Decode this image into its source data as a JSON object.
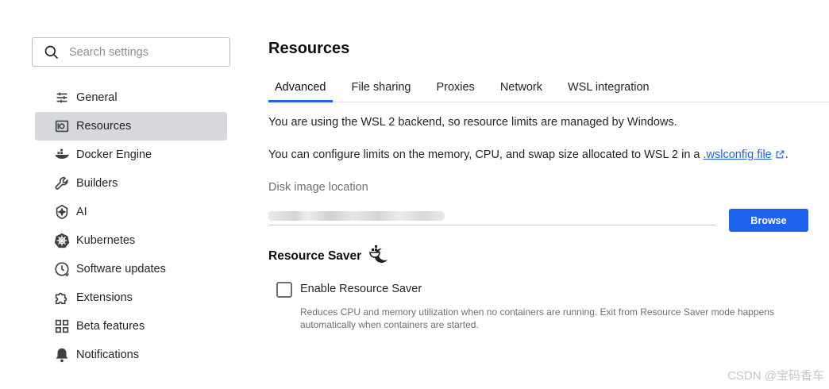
{
  "search": {
    "placeholder": "Search settings"
  },
  "sidebar": {
    "items": [
      {
        "label": "General",
        "icon": "sliders-icon"
      },
      {
        "label": "Resources",
        "icon": "resources-icon",
        "active": true
      },
      {
        "label": "Docker Engine",
        "icon": "docker-whale-icon"
      },
      {
        "label": "Builders",
        "icon": "wrench-icon"
      },
      {
        "label": "AI",
        "icon": "ai-sparkle-icon"
      },
      {
        "label": "Kubernetes",
        "icon": "kubernetes-helm-icon"
      },
      {
        "label": "Software updates",
        "icon": "clock-update-icon"
      },
      {
        "label": "Extensions",
        "icon": "puzzle-icon"
      },
      {
        "label": "Beta features",
        "icon": "grid-icon"
      },
      {
        "label": "Notifications",
        "icon": "bell-icon"
      }
    ]
  },
  "main": {
    "title": "Resources",
    "tabs": [
      {
        "label": "Advanced",
        "active": true
      },
      {
        "label": "File sharing"
      },
      {
        "label": "Proxies"
      },
      {
        "label": "Network"
      },
      {
        "label": "WSL integration"
      }
    ],
    "wsl_notice": "You are using the WSL 2 backend, so resource limits are managed by Windows.",
    "limits_text": "You can configure limits on the memory, CPU, and swap size allocated to WSL 2 in a ",
    "limits_link": ".wslconfig file",
    "limits_end": ".",
    "disk_label": "Disk image location",
    "browse_label": "Browse",
    "resource_saver": {
      "title": "Resource Saver",
      "checkbox_label": "Enable Resource Saver",
      "checked": false,
      "description": "Reduces CPU and memory utilization when no containers are running. Exit from Resource Saver mode happens automatically when containers are started."
    }
  },
  "watermark": "CSDN @宝码香车",
  "colors": {
    "accent": "#1d63ed",
    "active_bg": "#d6d8db"
  }
}
